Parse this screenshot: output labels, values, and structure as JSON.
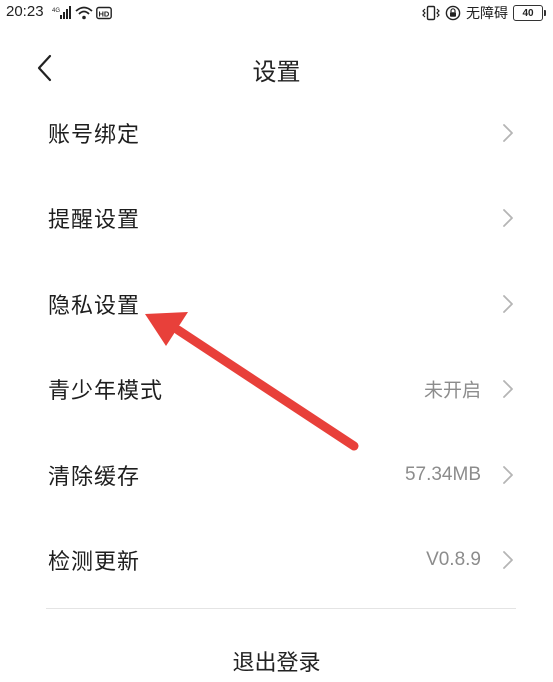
{
  "status_bar": {
    "time": "20:23",
    "accessibility_text": "无障碍",
    "battery_level": "40"
  },
  "header": {
    "title": "设置"
  },
  "settings": {
    "items": [
      {
        "label": "账号绑定",
        "value": ""
      },
      {
        "label": "提醒设置",
        "value": ""
      },
      {
        "label": "隐私设置",
        "value": ""
      },
      {
        "label": "青少年模式",
        "value": "未开启"
      },
      {
        "label": "清除缓存",
        "value": "57.34MB"
      },
      {
        "label": "检测更新",
        "value": "V0.8.9"
      }
    ]
  },
  "footer": {
    "logout_label": "退出登录"
  },
  "colors": {
    "annotation_arrow": "#e8403a",
    "secondary_text": "#8c8c8c",
    "divider": "#e4e4e4"
  }
}
